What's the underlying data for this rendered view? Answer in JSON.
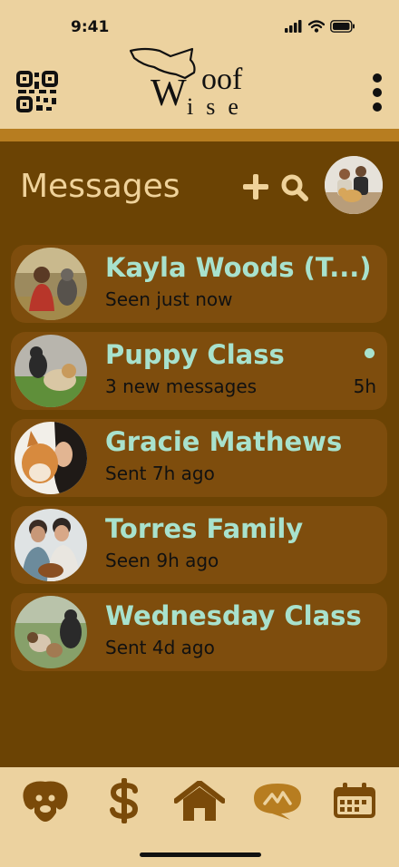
{
  "status_bar": {
    "time": "9:41"
  },
  "header": {
    "logo_text": "Woof Wise",
    "qr_icon": "qr-code-icon",
    "menu_icon": "more-vertical-icon"
  },
  "messages": {
    "title": "Messages",
    "add_icon": "plus-icon",
    "search_icon": "search-icon"
  },
  "conversations": [
    {
      "name": "Kayla Woods (T...)",
      "status": "Seen just now",
      "time": "",
      "unread": false
    },
    {
      "name": "Puppy Class",
      "status": "3 new messages",
      "time": "5h",
      "unread": true
    },
    {
      "name": "Gracie Mathews",
      "status": "Sent 7h ago",
      "time": "",
      "unread": false
    },
    {
      "name": "Torres Family",
      "status": "Seen 9h ago",
      "time": "",
      "unread": false
    },
    {
      "name": "Wednesday Class",
      "status": "Sent 4d ago",
      "time": "",
      "unread": false
    }
  ],
  "bottom_nav": [
    {
      "icon": "dog-icon"
    },
    {
      "icon": "dollar-icon"
    },
    {
      "icon": "home-icon"
    },
    {
      "icon": "chat-bubble-icon",
      "active": true
    },
    {
      "icon": "calendar-icon"
    }
  ],
  "colors": {
    "header_bg": "#ecd29f",
    "accent_stripe": "#b77d20",
    "body_bg": "#6b4304",
    "card_bg": "#7e4d0d",
    "name_color": "#a8e2cd",
    "title_color": "#efd29a",
    "nav_icon": "#7a4a09"
  }
}
